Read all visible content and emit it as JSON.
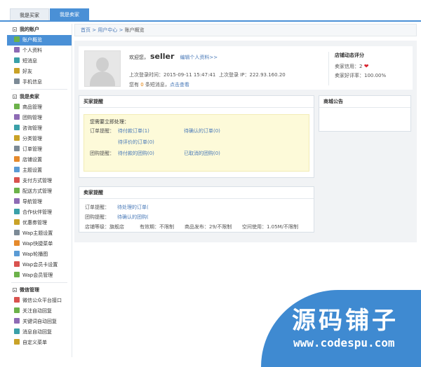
{
  "tabs": [
    {
      "label": "我是买家",
      "active": false
    },
    {
      "label": "我是卖家",
      "active": true
    }
  ],
  "sidebar": {
    "section_account": "我的账户",
    "account_items": [
      "账户概览",
      "个人资料",
      "短消息",
      "好友",
      "手机信息"
    ],
    "section_seller": "我是卖家",
    "seller_items": [
      "商品管理",
      "团购管理",
      "咨询管理",
      "分类管理",
      "订单管理",
      "店铺设置",
      "主题设置",
      "支付方式管理",
      "配送方式管理",
      "导航管理",
      "合作伙伴管理",
      "优惠劵管理",
      "Wap主题设置",
      "Wap快捷菜单",
      "Wap轮播图",
      "Wap会员卡设置",
      "Wap会员管理"
    ],
    "section_wechat": "微信管理",
    "wechat_items": [
      "微信公众平台接口",
      "关注自动回复",
      "关键词自动回复",
      "消息自动回复",
      "自定义菜单"
    ]
  },
  "breadcrumb": {
    "home": "首页",
    "sep": ">",
    "center": "用户中心",
    "current": "账户概览"
  },
  "profile": {
    "welcome": "欢迎您，",
    "username": "seller",
    "edit_link": "编辑个人资料>>",
    "last_login_time": "上次登录时间：2015-09-11 15:47:41",
    "last_login_ip": "上次登录 IP：222.93.160.20",
    "msg_prefix": "您有",
    "msg_count": "0",
    "msg_suffix": "条短消息，",
    "msg_link": "点击查看"
  },
  "rating": {
    "title": "店铺动态评分",
    "credit": "卖家信用：2",
    "good": "卖家好评率：100.00%"
  },
  "buyer_panel": {
    "title": "买家提醒",
    "pending": "您需要立即处理：",
    "order_label": "订单提醒：",
    "order_unpaid": "待付款订单(1)",
    "order_confirm": "待确认的订单(0)",
    "order_review": "待评价的订单(0)",
    "group_label": "团购提醒：",
    "group_unpaid": "待付款的团购(0)",
    "group_cancel": "已取消的团购(0)"
  },
  "notice_panel": {
    "title": "商城公告"
  },
  "seller_panel": {
    "title": "卖家提醒",
    "order_label": "订单提醒：",
    "order_pending": "待处理的订单(",
    "group_label": "团购提醒：",
    "group_pending": "待确认的团购(",
    "shop_level": "店铺等级：旗舰店",
    "valid": "有效期：不限制",
    "goods": "商品发布：29/不限制",
    "space": "空间使用：1.05M/不限制"
  },
  "watermark": {
    "zh": "源码铺子",
    "en": "www.codespu.com"
  },
  "colors": {
    "accent": "#4a90d6",
    "link": "#4a7ab8",
    "highlight": "#fdfad9"
  }
}
